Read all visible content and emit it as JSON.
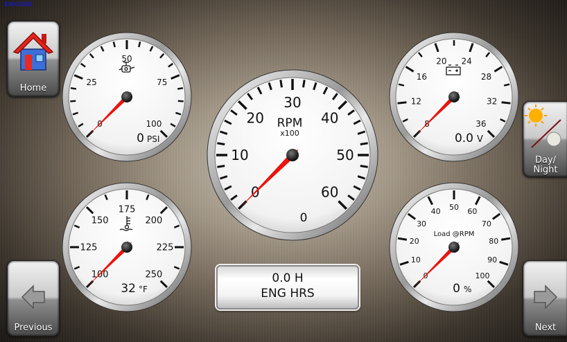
{
  "header": {
    "label": "ENGINE"
  },
  "nav": {
    "home_label": "Home",
    "day_night_label_1": "Day/",
    "day_night_label_2": "Night",
    "previous_label": "Previous",
    "next_label": "Next"
  },
  "colors": {
    "needle": "#e8150e",
    "face": "#ffffff",
    "ticks": "#111111"
  },
  "gauges": {
    "oil_pressure": {
      "icon": "oil-can-icon",
      "min": 0,
      "max": 100,
      "value": 0,
      "tick_labels": [
        "0",
        "25",
        "50",
        "75",
        "100"
      ],
      "readout": "0",
      "unit": "PSI"
    },
    "rpm": {
      "label": "RPM",
      "sublabel": "x100",
      "min": 0,
      "max": 60,
      "value": 0,
      "tick_labels": [
        "0",
        "10",
        "20",
        "30",
        "40",
        "50",
        "60"
      ],
      "readout": "0"
    },
    "voltage": {
      "icon": "battery-icon",
      "min": 8,
      "max": 36,
      "value": 0.0,
      "tick_labels": [
        "8",
        "12",
        "16",
        "20",
        "24",
        "28",
        "32",
        "36"
      ],
      "readout": "0.0",
      "unit": "V"
    },
    "coolant_temp": {
      "icon": "coolant-temperature-icon",
      "min": 100,
      "max": 250,
      "value": 32,
      "tick_labels": [
        "100",
        "125",
        "150",
        "175",
        "200",
        "225",
        "250"
      ],
      "readout": "32",
      "unit": "°F"
    },
    "load": {
      "label": "Load @RPM",
      "min": 0,
      "max": 100,
      "value": 0,
      "tick_labels": [
        "0",
        "10",
        "20",
        "30",
        "40",
        "50",
        "60",
        "70",
        "80",
        "90",
        "100"
      ],
      "readout": "0",
      "unit": "%"
    }
  },
  "engine_hours": {
    "value": "0.0 H",
    "label": "ENG HRS"
  }
}
